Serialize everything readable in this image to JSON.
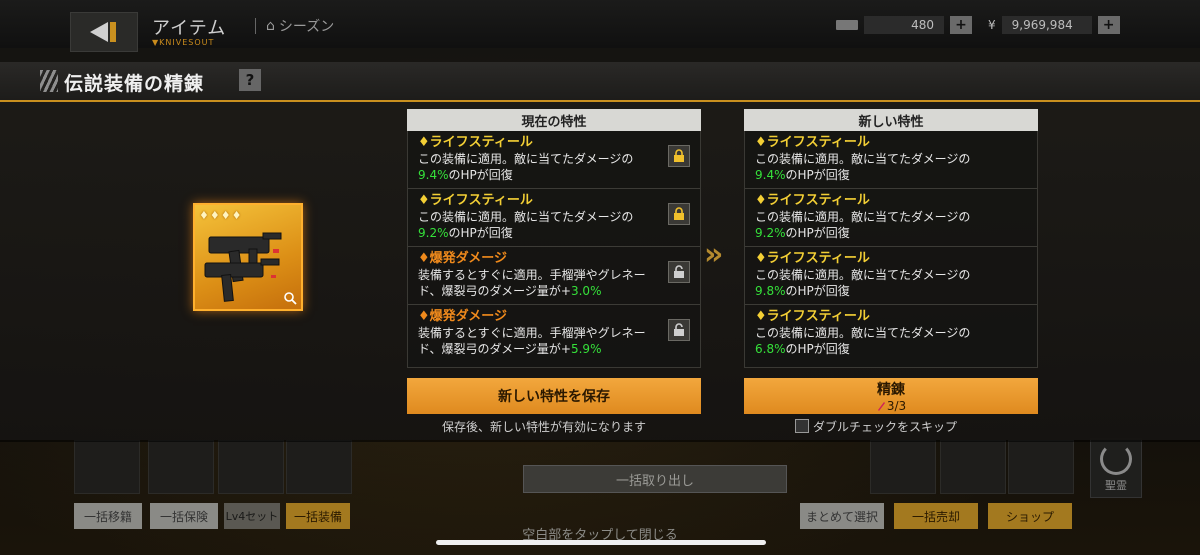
{
  "header": {
    "title": "アイテム",
    "brand": "▼KNIVESOUT",
    "season_label": "シーズン",
    "ticket_value": "480",
    "money_symbol": "¥",
    "money_value": "9,969,984",
    "plus": "+"
  },
  "modal": {
    "title": "伝説装備の精錬",
    "help": "?",
    "current": {
      "header": "現在の特性",
      "traits": [
        {
          "name": "ライフスティール",
          "desc_pre": "この装備に適用。敵に当てたダメージの",
          "value": "9.4%",
          "desc_post": "のHPが回復",
          "lock": "locked"
        },
        {
          "name": "ライフスティール",
          "desc_pre": "この装備に適用。敵に当てたダメージの",
          "value": "9.2%",
          "desc_post": "のHPが回復",
          "lock": "locked"
        },
        {
          "name": "爆発ダメージ",
          "desc_pre": "装備するとすぐに適用。手榴弾やグレネード、爆裂弓のダメージ量が+",
          "value": "3.0%",
          "desc_post": "",
          "lock": "unlocked"
        },
        {
          "name": "爆発ダメージ",
          "desc_pre": "装備するとすぐに適用。手榴弾やグレネード、爆裂弓のダメージ量が+",
          "value": "5.9%",
          "desc_post": "",
          "lock": "unlocked"
        }
      ]
    },
    "new": {
      "header": "新しい特性",
      "traits": [
        {
          "name": "ライフスティール",
          "desc_pre": "この装備に適用。敵に当てたダメージの",
          "value": "9.4%",
          "desc_post": "のHPが回復"
        },
        {
          "name": "ライフスティール",
          "desc_pre": "この装備に適用。敵に当てたダメージの",
          "value": "9.2%",
          "desc_post": "のHPが回復"
        },
        {
          "name": "ライフスティール",
          "desc_pre": "この装備に適用。敵に当てたダメージの",
          "value": "9.8%",
          "desc_post": "のHPが回復"
        },
        {
          "name": "ライフスティール",
          "desc_pre": "この装備に適用。敵に当てたダメージの",
          "value": "6.8%",
          "desc_post": "のHPが回復"
        }
      ]
    },
    "arrow": "»",
    "item_stars": [
      "♦",
      "♦",
      "♦",
      "♦"
    ],
    "save_button": "新しい特性を保存",
    "save_note": "保存後、新しい特性が有効になります",
    "refine_button": "精錬",
    "refine_count": "3/3",
    "skip_check_label": "ダブルチェックをスキップ"
  },
  "background": {
    "bulk_takeout": "一括取り出し",
    "buttons_left": [
      "一括移籍",
      "一括保険",
      "Lv4セット",
      "一括装備"
    ],
    "buttons_right": [
      "まとめて選択",
      "一括売却",
      "ショップ"
    ],
    "right_icon_label": "聖霊",
    "tap_close": "空白部をタップして閉じる"
  },
  "colors": {
    "accent_gold": "#c9901f",
    "button_orange": "#ef9f33",
    "value_green": "#35e03a",
    "trait_yellow": "#f3cf35",
    "trait_orange": "#f08a1c"
  }
}
